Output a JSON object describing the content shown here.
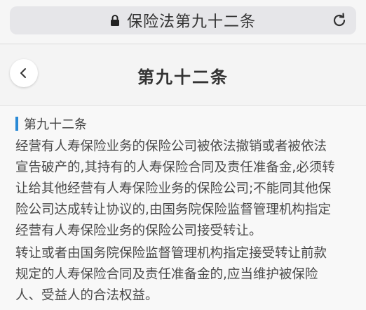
{
  "browser": {
    "url_title": "保险法第九十二条",
    "lock_icon": "lock-icon",
    "reload_icon": "reload-icon"
  },
  "nav": {
    "back_icon": "chevron-left-icon",
    "title": "第九十二条"
  },
  "article": {
    "heading": "第九十二条",
    "accent_color": "#2a8ad6",
    "paragraph1_lines": [
      "经营有人寿保险业务的保险公司被依法撤销或者被依法",
      "宣告破产的,其持有的人寿保险合同及责任准备金,必须转",
      "让给其他经营有人寿保险业务的保险公司;不能同其他保",
      "险公司达成转让协议的,由国务院保险监督管理机构指定",
      "经营有人寿保险业务的保险公司接受转让。"
    ],
    "paragraph2_lines": [
      "转让或者由国务院保险监督管理机构指定接受转让前款",
      "规定的人寿保险合同及责任准备金的,应当维护被保险",
      "人、受益人的合法权益。"
    ]
  }
}
